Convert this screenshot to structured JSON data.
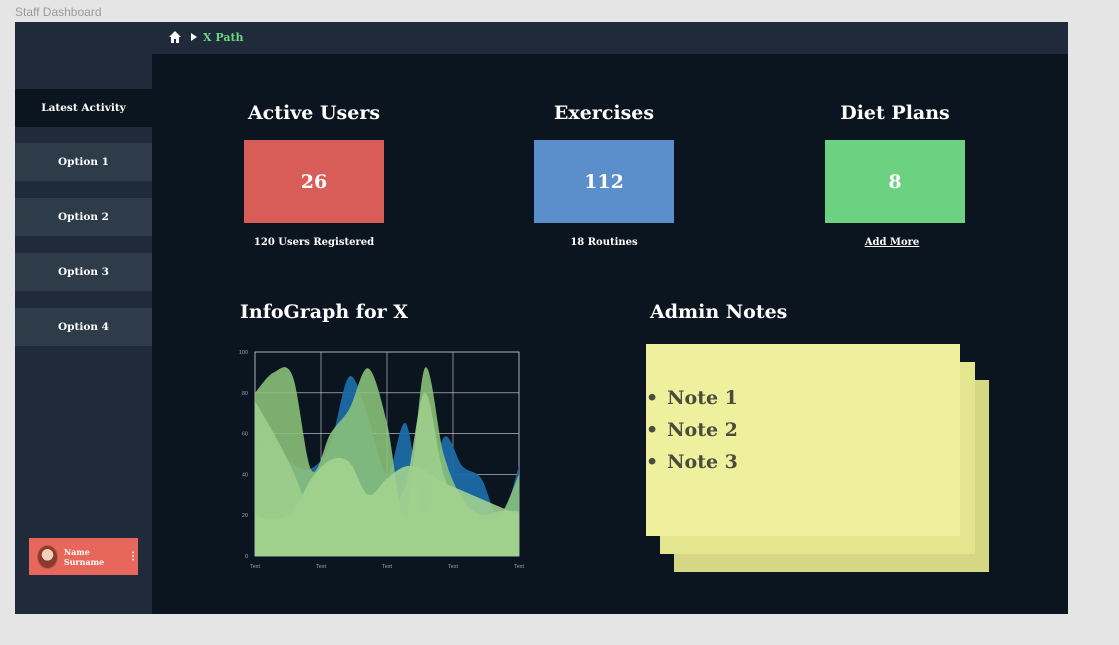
{
  "frame_title": "Staff Dashboard",
  "breadcrumb": {
    "path": "X Path",
    "icon": "home-icon"
  },
  "sidebar": {
    "items": [
      {
        "label": "Latest Activity",
        "active": true
      },
      {
        "label": "Option 1",
        "active": false
      },
      {
        "label": "Option 2",
        "active": false
      },
      {
        "label": "Option 3",
        "active": false
      },
      {
        "label": "Option 4",
        "active": false
      }
    ],
    "profile": {
      "name": "Name Surname",
      "menu_icon": "kebab-icon"
    }
  },
  "stats": [
    {
      "title": "Active Users",
      "value": "26",
      "subtitle": "120 Users Registered",
      "color": "#d85d59"
    },
    {
      "title": "Exercises",
      "value": "112",
      "subtitle": "18 Routines",
      "color": "#5b8fcc"
    },
    {
      "title": "Diet Plans",
      "value": "8",
      "subtitle": "Add More",
      "color": "#6cd281"
    }
  ],
  "infograph": {
    "title": "InfoGraph for X"
  },
  "admin_notes": {
    "title": "Admin Notes",
    "notes": [
      "Note 1",
      "Note 2",
      "Note 3"
    ],
    "note_color": "#eef09e"
  },
  "chart_data": {
    "type": "area",
    "categories": [
      "Text",
      "Text",
      "Text",
      "Text",
      "Text"
    ],
    "ylim": [
      0,
      100
    ],
    "y_ticks": [
      "100",
      "80",
      "60",
      "40",
      "20",
      "0"
    ],
    "grid": true,
    "series": [
      {
        "color": "#1d6aa6",
        "values": [
          52,
          55,
          45,
          43,
          55,
          88,
          68,
          40,
          65,
          20,
          58,
          44,
          38,
          18,
          44
        ]
      },
      {
        "color": "#8cc47a",
        "values": [
          80,
          90,
          88,
          42,
          60,
          72,
          92,
          65,
          18,
          92,
          50,
          28,
          20,
          20,
          40
        ]
      },
      {
        "color": "#a4d48e",
        "values": [
          20,
          18,
          22,
          38,
          47,
          46,
          30,
          38,
          44,
          42,
          36,
          32,
          28,
          24,
          20
        ]
      },
      {
        "color": "#9fcf8c",
        "values": [
          76,
          60,
          42,
          20,
          15,
          12,
          12,
          22,
          35,
          80,
          40,
          22,
          20,
          22,
          22
        ]
      }
    ]
  }
}
